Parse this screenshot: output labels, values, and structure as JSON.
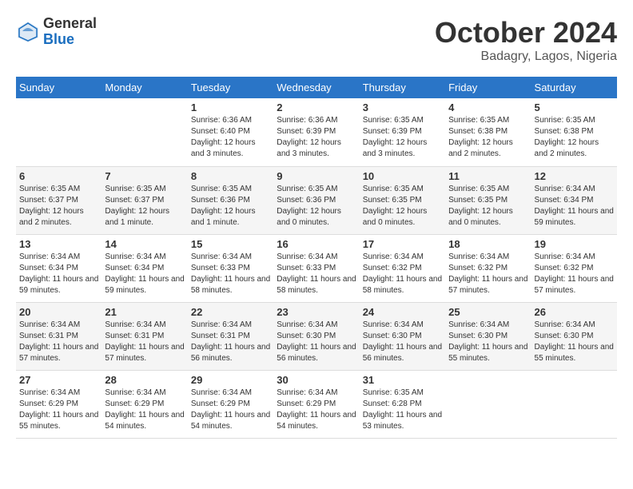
{
  "header": {
    "logo_general": "General",
    "logo_blue": "Blue",
    "month_title": "October 2024",
    "location": "Badagry, Lagos, Nigeria"
  },
  "days_of_week": [
    "Sunday",
    "Monday",
    "Tuesday",
    "Wednesday",
    "Thursday",
    "Friday",
    "Saturday"
  ],
  "weeks": [
    [
      {
        "day": "",
        "info": ""
      },
      {
        "day": "",
        "info": ""
      },
      {
        "day": "1",
        "info": "Sunrise: 6:36 AM\nSunset: 6:40 PM\nDaylight: 12 hours and 3 minutes."
      },
      {
        "day": "2",
        "info": "Sunrise: 6:36 AM\nSunset: 6:39 PM\nDaylight: 12 hours and 3 minutes."
      },
      {
        "day": "3",
        "info": "Sunrise: 6:35 AM\nSunset: 6:39 PM\nDaylight: 12 hours and 3 minutes."
      },
      {
        "day": "4",
        "info": "Sunrise: 6:35 AM\nSunset: 6:38 PM\nDaylight: 12 hours and 2 minutes."
      },
      {
        "day": "5",
        "info": "Sunrise: 6:35 AM\nSunset: 6:38 PM\nDaylight: 12 hours and 2 minutes."
      }
    ],
    [
      {
        "day": "6",
        "info": "Sunrise: 6:35 AM\nSunset: 6:37 PM\nDaylight: 12 hours and 2 minutes."
      },
      {
        "day": "7",
        "info": "Sunrise: 6:35 AM\nSunset: 6:37 PM\nDaylight: 12 hours and 1 minute."
      },
      {
        "day": "8",
        "info": "Sunrise: 6:35 AM\nSunset: 6:36 PM\nDaylight: 12 hours and 1 minute."
      },
      {
        "day": "9",
        "info": "Sunrise: 6:35 AM\nSunset: 6:36 PM\nDaylight: 12 hours and 0 minutes."
      },
      {
        "day": "10",
        "info": "Sunrise: 6:35 AM\nSunset: 6:35 PM\nDaylight: 12 hours and 0 minutes."
      },
      {
        "day": "11",
        "info": "Sunrise: 6:35 AM\nSunset: 6:35 PM\nDaylight: 12 hours and 0 minutes."
      },
      {
        "day": "12",
        "info": "Sunrise: 6:34 AM\nSunset: 6:34 PM\nDaylight: 11 hours and 59 minutes."
      }
    ],
    [
      {
        "day": "13",
        "info": "Sunrise: 6:34 AM\nSunset: 6:34 PM\nDaylight: 11 hours and 59 minutes."
      },
      {
        "day": "14",
        "info": "Sunrise: 6:34 AM\nSunset: 6:34 PM\nDaylight: 11 hours and 59 minutes."
      },
      {
        "day": "15",
        "info": "Sunrise: 6:34 AM\nSunset: 6:33 PM\nDaylight: 11 hours and 58 minutes."
      },
      {
        "day": "16",
        "info": "Sunrise: 6:34 AM\nSunset: 6:33 PM\nDaylight: 11 hours and 58 minutes."
      },
      {
        "day": "17",
        "info": "Sunrise: 6:34 AM\nSunset: 6:32 PM\nDaylight: 11 hours and 58 minutes."
      },
      {
        "day": "18",
        "info": "Sunrise: 6:34 AM\nSunset: 6:32 PM\nDaylight: 11 hours and 57 minutes."
      },
      {
        "day": "19",
        "info": "Sunrise: 6:34 AM\nSunset: 6:32 PM\nDaylight: 11 hours and 57 minutes."
      }
    ],
    [
      {
        "day": "20",
        "info": "Sunrise: 6:34 AM\nSunset: 6:31 PM\nDaylight: 11 hours and 57 minutes."
      },
      {
        "day": "21",
        "info": "Sunrise: 6:34 AM\nSunset: 6:31 PM\nDaylight: 11 hours and 57 minutes."
      },
      {
        "day": "22",
        "info": "Sunrise: 6:34 AM\nSunset: 6:31 PM\nDaylight: 11 hours and 56 minutes."
      },
      {
        "day": "23",
        "info": "Sunrise: 6:34 AM\nSunset: 6:30 PM\nDaylight: 11 hours and 56 minutes."
      },
      {
        "day": "24",
        "info": "Sunrise: 6:34 AM\nSunset: 6:30 PM\nDaylight: 11 hours and 56 minutes."
      },
      {
        "day": "25",
        "info": "Sunrise: 6:34 AM\nSunset: 6:30 PM\nDaylight: 11 hours and 55 minutes."
      },
      {
        "day": "26",
        "info": "Sunrise: 6:34 AM\nSunset: 6:30 PM\nDaylight: 11 hours and 55 minutes."
      }
    ],
    [
      {
        "day": "27",
        "info": "Sunrise: 6:34 AM\nSunset: 6:29 PM\nDaylight: 11 hours and 55 minutes."
      },
      {
        "day": "28",
        "info": "Sunrise: 6:34 AM\nSunset: 6:29 PM\nDaylight: 11 hours and 54 minutes."
      },
      {
        "day": "29",
        "info": "Sunrise: 6:34 AM\nSunset: 6:29 PM\nDaylight: 11 hours and 54 minutes."
      },
      {
        "day": "30",
        "info": "Sunrise: 6:34 AM\nSunset: 6:29 PM\nDaylight: 11 hours and 54 minutes."
      },
      {
        "day": "31",
        "info": "Sunrise: 6:35 AM\nSunset: 6:28 PM\nDaylight: 11 hours and 53 minutes."
      },
      {
        "day": "",
        "info": ""
      },
      {
        "day": "",
        "info": ""
      }
    ]
  ]
}
